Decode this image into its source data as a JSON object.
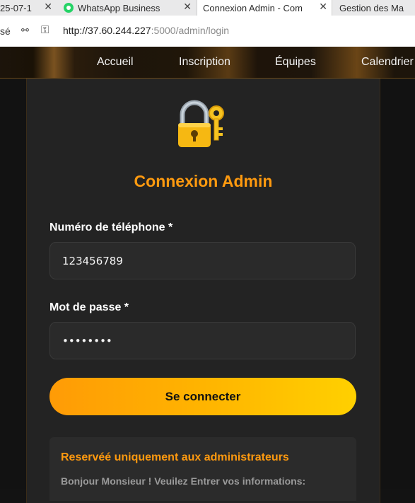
{
  "browser": {
    "tabs": [
      {
        "label": "25-07-1",
        "close": "✕"
      },
      {
        "label": "WhatsApp Business",
        "close": "✕"
      },
      {
        "label": "Connexion Admin - Com",
        "close": "✕"
      },
      {
        "label": "Gestion des Ma"
      }
    ],
    "address": {
      "left_text": "sé",
      "url_host": "http://37.60.244.227",
      "url_path": ":5000/admin/login"
    }
  },
  "nav": {
    "items": [
      "Accueil",
      "Inscription",
      "Équipes",
      "Calendrier"
    ]
  },
  "login": {
    "icon": "lock-with-key-icon",
    "title": "Connexion Admin",
    "phone_label": "Numéro de téléphone *",
    "phone_value": "123456789",
    "password_label": "Mot de passe *",
    "password_value": "12345678",
    "submit_label": "Se connecter"
  },
  "info": {
    "title": "Reservéé uniquement aux administrateurs",
    "text": "Bonjour Monsieur ! Veuilez Entrer vos informations:"
  },
  "colors": {
    "accent": "#ff9a0f",
    "card": "#232323",
    "background": "#121212"
  }
}
